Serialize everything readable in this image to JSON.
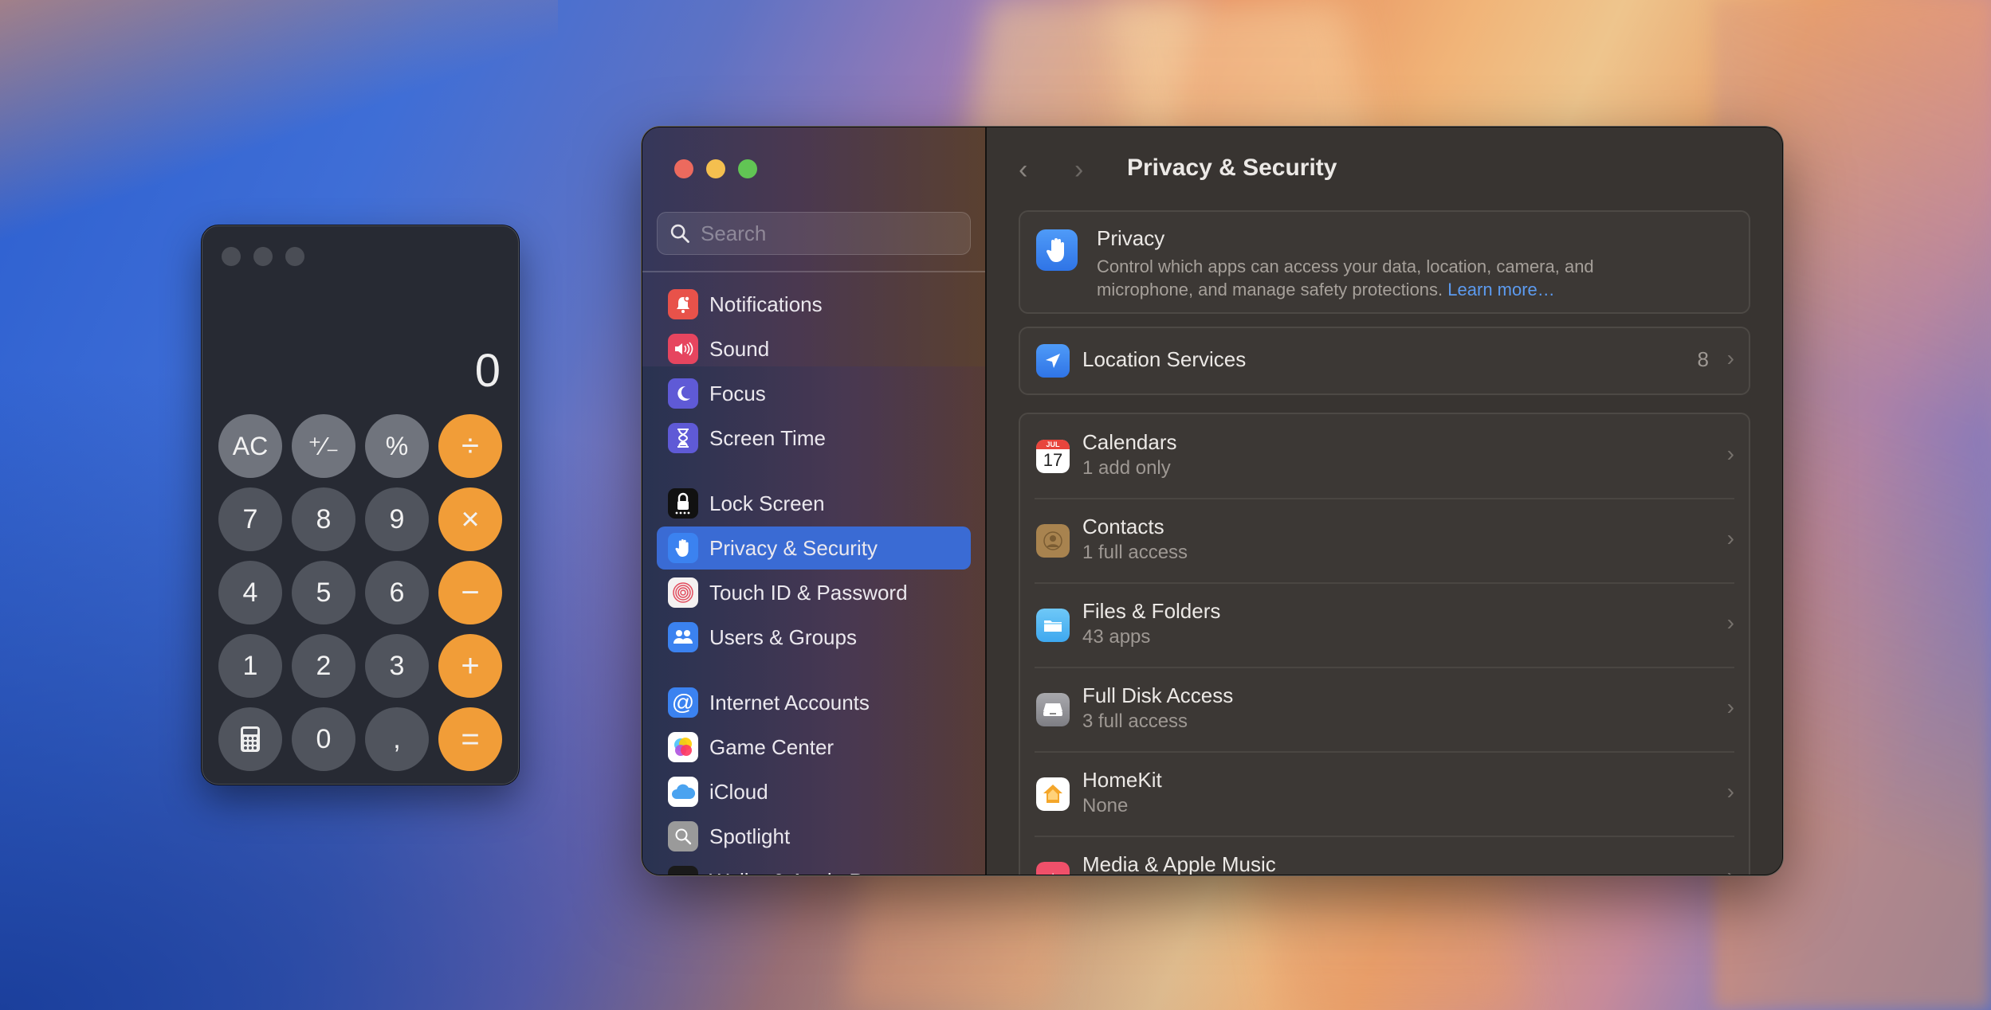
{
  "calculator": {
    "display": "0",
    "keys": [
      {
        "label": "AC",
        "kind": "fn",
        "name": "all-clear-key"
      },
      {
        "label": "⁺∕₋",
        "kind": "fn",
        "name": "plus-minus-key"
      },
      {
        "label": "%",
        "kind": "fn",
        "name": "percent-key"
      },
      {
        "label": "÷",
        "kind": "op",
        "name": "divide-key"
      },
      {
        "label": "7",
        "kind": "num",
        "name": "digit-7-key"
      },
      {
        "label": "8",
        "kind": "num",
        "name": "digit-8-key"
      },
      {
        "label": "9",
        "kind": "num",
        "name": "digit-9-key"
      },
      {
        "label": "×",
        "kind": "op",
        "name": "multiply-key"
      },
      {
        "label": "4",
        "kind": "num",
        "name": "digit-4-key"
      },
      {
        "label": "5",
        "kind": "num",
        "name": "digit-5-key"
      },
      {
        "label": "6",
        "kind": "num",
        "name": "digit-6-key"
      },
      {
        "label": "−",
        "kind": "op",
        "name": "subtract-key"
      },
      {
        "label": "1",
        "kind": "num",
        "name": "digit-1-key"
      },
      {
        "label": "2",
        "kind": "num",
        "name": "digit-2-key"
      },
      {
        "label": "3",
        "kind": "num",
        "name": "digit-3-key"
      },
      {
        "label": "+",
        "kind": "op",
        "name": "add-key"
      },
      {
        "label": "",
        "kind": "num",
        "name": "calculator-mode-key",
        "icon": "calculator-icon"
      },
      {
        "label": "0",
        "kind": "num",
        "name": "digit-0-key"
      },
      {
        "label": ",",
        "kind": "num",
        "name": "decimal-key"
      },
      {
        "label": "=",
        "kind": "op",
        "name": "equals-key"
      }
    ],
    "colors": {
      "operator": "#f19d38",
      "function": "#70747d",
      "number": "#50545d"
    }
  },
  "settings": {
    "search": {
      "placeholder": "Search",
      "value": ""
    },
    "sidebar": {
      "items": [
        {
          "label": "Notifications",
          "icon": "bell-icon",
          "color": "#e8524a"
        },
        {
          "label": "Sound",
          "icon": "speaker-icon",
          "color": "#e6455f"
        },
        {
          "label": "Focus",
          "icon": "moon-icon",
          "color": "#5f5ad6"
        },
        {
          "label": "Screen Time",
          "icon": "hourglass-icon",
          "color": "#5f5ad6"
        },
        {
          "label": "Lock Screen",
          "icon": "lock-icon",
          "color": "#111111"
        },
        {
          "label": "Privacy & Security",
          "icon": "hand-icon",
          "color": "#3b82f0",
          "selected": true
        },
        {
          "label": "Touch ID & Password",
          "icon": "fingerprint-icon",
          "color": "#f4f1f1"
        },
        {
          "label": "Users & Groups",
          "icon": "users-icon",
          "color": "#3b82f0"
        },
        {
          "label": "Internet Accounts",
          "icon": "at-icon",
          "color": "#3b82f0"
        },
        {
          "label": "Game Center",
          "icon": "game-center-icon",
          "color": "#ffffff"
        },
        {
          "label": "iCloud",
          "icon": "cloud-icon",
          "color": "#ffffff"
        },
        {
          "label": "Spotlight",
          "icon": "magnifier-icon",
          "color": "#9a9a9a"
        },
        {
          "label": "Wallet & Apple Pay",
          "icon": "wallet-icon",
          "color": "#1a1a1a"
        }
      ]
    },
    "pane": {
      "title": "Privacy & Security",
      "back_label": "‹",
      "forward_label": "›",
      "privacy_card": {
        "title": "Privacy",
        "description": "Control which apps can access your data, location, camera, and microphone, and manage safety protections.",
        "link": "Learn more…"
      },
      "location": {
        "title": "Location Services",
        "count": "8"
      },
      "rows": [
        {
          "title": "Calendars",
          "subtitle": "1 add only",
          "icon": "calendar-icon"
        },
        {
          "title": "Contacts",
          "subtitle": "1 full access",
          "icon": "contacts-icon"
        },
        {
          "title": "Files & Folders",
          "subtitle": "43 apps",
          "icon": "folder-icon"
        },
        {
          "title": "Full Disk Access",
          "subtitle": "3 full access",
          "icon": "disk-icon"
        },
        {
          "title": "HomeKit",
          "subtitle": "None",
          "icon": "home-icon"
        },
        {
          "title": "Media & Apple Music",
          "subtitle": "",
          "icon": "music-icon"
        }
      ],
      "calendar_month": "JUL",
      "calendar_day": "17"
    },
    "accent": "#3a6bd4"
  }
}
